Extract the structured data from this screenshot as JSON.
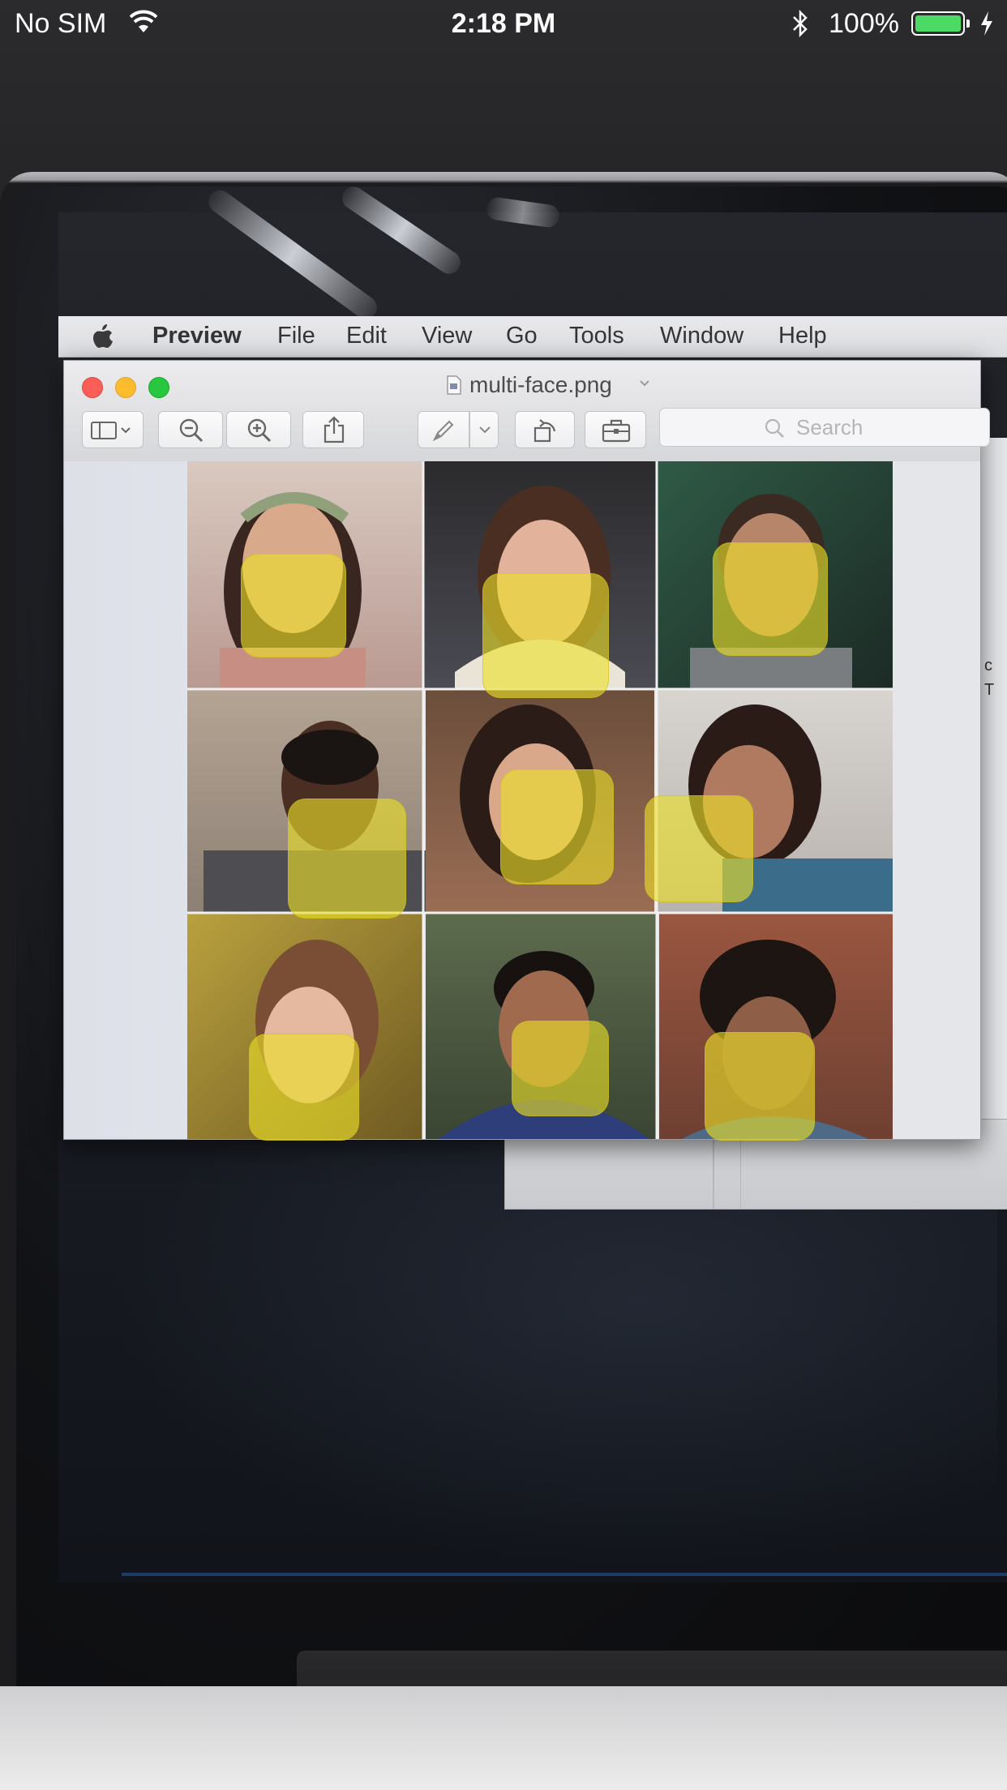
{
  "status_bar": {
    "carrier": "No SIM",
    "time": "2:18 PM",
    "battery_percent": "100%",
    "battery_level": 1.0,
    "battery_color": "#4cd964",
    "icons": [
      "wifi-icon",
      "bluetooth-icon",
      "battery-icon",
      "charging-bolt-icon"
    ]
  },
  "menu_bar": {
    "apple_icon": "apple-icon",
    "app_name": "Preview",
    "items": [
      "File",
      "Edit",
      "View",
      "Go",
      "Tools",
      "Window",
      "Help"
    ]
  },
  "window": {
    "title": "multi-face.png",
    "controls": [
      "close",
      "minimize",
      "zoom"
    ],
    "toolbar": {
      "buttons": [
        "sidebar-toggle",
        "zoom-out",
        "zoom-in",
        "share",
        "markup-pen",
        "markup-dropdown",
        "rotate",
        "toolbox"
      ],
      "search_placeholder": "Search"
    },
    "overlay_color": "#ece028"
  },
  "faces": {
    "count": 9,
    "grid": "3x3"
  },
  "colors": {
    "face_box": "#ece028",
    "traffic_close": "#fc5d57",
    "traffic_min": "#fdbb2e",
    "traffic_max": "#27c840"
  }
}
